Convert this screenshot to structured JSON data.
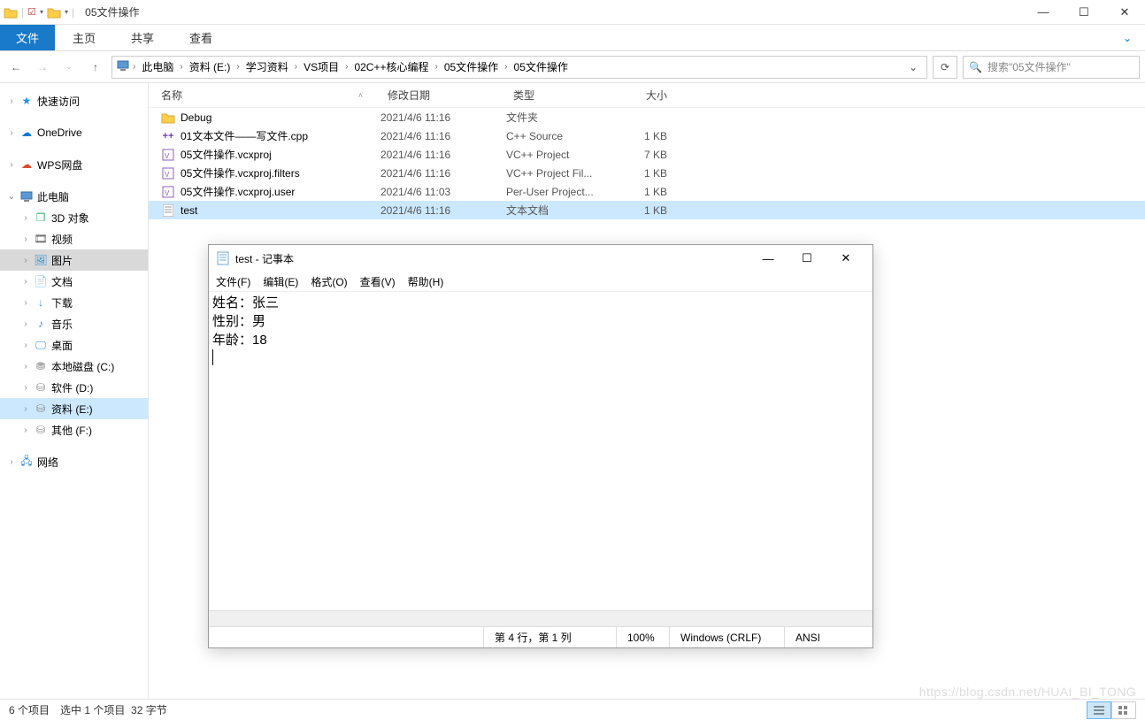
{
  "window": {
    "title": "05文件操作"
  },
  "ribbon": {
    "file": "文件",
    "tabs": [
      "主页",
      "共享",
      "查看"
    ]
  },
  "breadcrumb": [
    "此电脑",
    "资料 (E:)",
    "学习资料",
    "VS项目",
    "02C++核心编程",
    "05文件操作",
    "05文件操作"
  ],
  "search": {
    "placeholder": "搜索\"05文件操作\""
  },
  "columns": {
    "name": "名称",
    "date": "修改日期",
    "type": "类型",
    "size": "大小"
  },
  "sidebar": {
    "quick": "快速访问",
    "onedrive": "OneDrive",
    "wps": "WPS网盘",
    "thispc": "此电脑",
    "pc_items": [
      "3D 对象",
      "视频",
      "图片",
      "文档",
      "下载",
      "音乐",
      "桌面",
      "本地磁盘 (C:)",
      "软件 (D:)",
      "资料 (E:)",
      "其他 (F:)"
    ],
    "network": "网络"
  },
  "files": [
    {
      "icon": "folder",
      "name": "Debug",
      "date": "2021/4/6 11:16",
      "type": "文件夹",
      "size": ""
    },
    {
      "icon": "cpp",
      "name": "01文本文件——写文件.cpp",
      "date": "2021/4/6 11:16",
      "type": "C++ Source",
      "size": "1 KB"
    },
    {
      "icon": "vcx",
      "name": "05文件操作.vcxproj",
      "date": "2021/4/6 11:16",
      "type": "VC++ Project",
      "size": "7 KB"
    },
    {
      "icon": "vcx",
      "name": "05文件操作.vcxproj.filters",
      "date": "2021/4/6 11:16",
      "type": "VC++ Project Fil...",
      "size": "1 KB"
    },
    {
      "icon": "vcx",
      "name": "05文件操作.vcxproj.user",
      "date": "2021/4/6 11:03",
      "type": "Per-User Project...",
      "size": "1 KB"
    },
    {
      "icon": "txt",
      "name": "test",
      "date": "2021/4/6 11:16",
      "type": "文本文档",
      "size": "1 KB",
      "selected": true
    }
  ],
  "status": {
    "count": "6 个项目",
    "sel": "选中 1 个项目",
    "bytes": "32 字节"
  },
  "notepad": {
    "title": "test - 记事本",
    "menus": [
      "文件(F)",
      "编辑(E)",
      "格式(O)",
      "查看(V)",
      "帮助(H)"
    ],
    "lines": [
      "姓名：张三",
      "性别：男",
      "年龄：18"
    ],
    "status": {
      "pos": "第 4 行，第 1 列",
      "zoom": "100%",
      "eol": "Windows (CRLF)",
      "enc": "ANSI"
    }
  },
  "watermark": "https://blog.csdn.net/HUAI_BI_TONG"
}
